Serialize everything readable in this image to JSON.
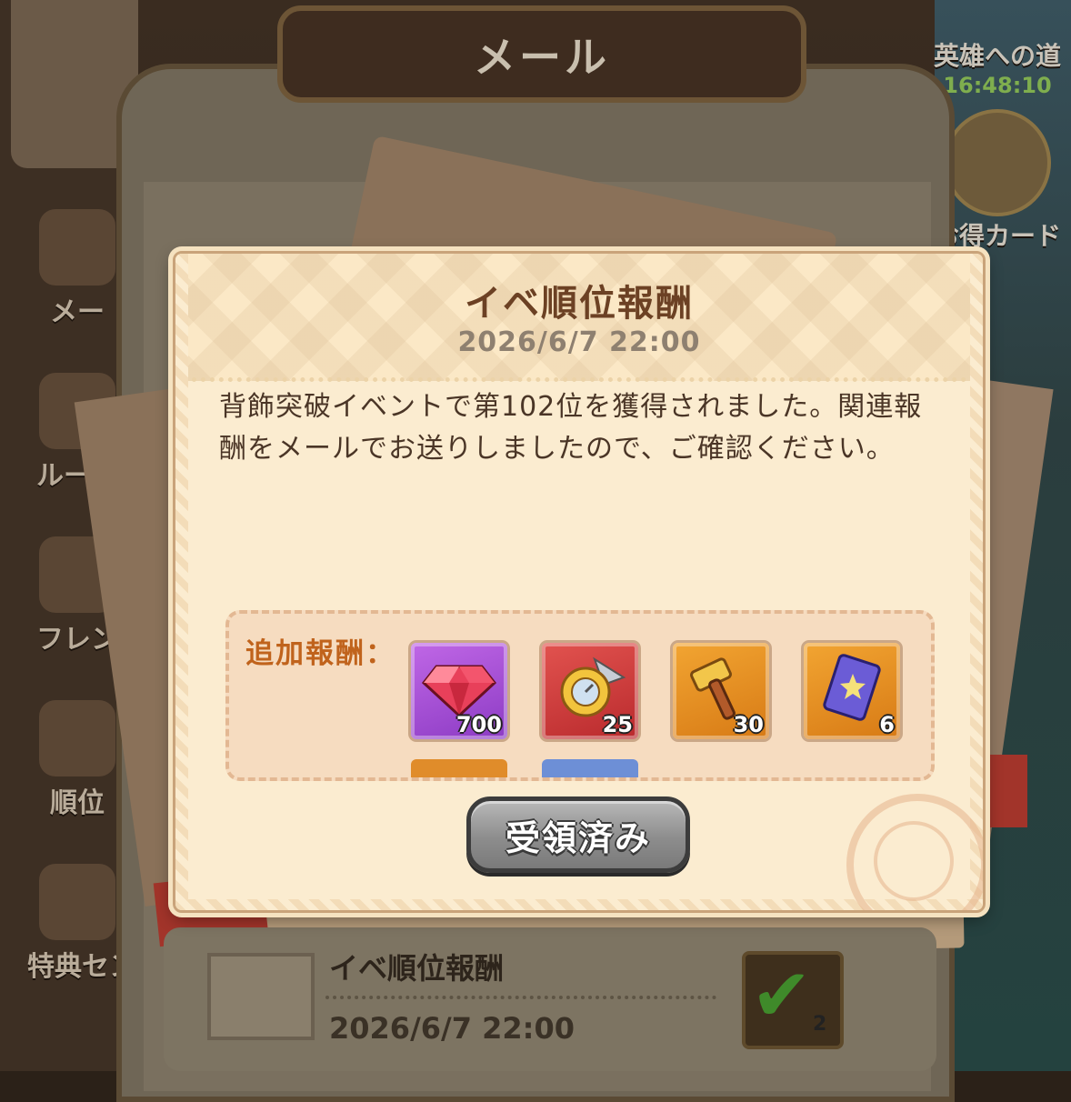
{
  "window_title": "メール",
  "sidebar": {
    "items": [
      {
        "label": "メー"
      },
      {
        "label": "ルーレ"
      },
      {
        "label": "フレン"
      },
      {
        "label": "順位"
      },
      {
        "label": "特典セン"
      }
    ]
  },
  "right_panel": {
    "hero_label": "英雄への道",
    "hero_timer": "16:48:10",
    "card_label": "お得カード"
  },
  "popup": {
    "title": "イベ順位報酬",
    "date": "2026/6/7  22:00",
    "body": "背飾突破イベントで第102位を獲得されました。関連報酬をメールでお送りしましたので、ご確認ください。",
    "reward_label": "追加報酬：",
    "rewards": [
      {
        "icon": "gem-icon",
        "count": "700",
        "frame": "purple"
      },
      {
        "icon": "compass-axe-icon",
        "count": "25",
        "frame": "red"
      },
      {
        "icon": "hammer-icon",
        "count": "30",
        "frame": "orange"
      },
      {
        "icon": "card-icon",
        "count": "6",
        "frame": "orange"
      }
    ],
    "claim_button": "受領済み"
  },
  "mail_list": {
    "item_title": "イベ順位報酬",
    "item_date": "2026/6/7  22:00",
    "item_count": "2"
  },
  "colors": {
    "title_text": "#6c4124",
    "reward_label": "#c0631c",
    "paper": "#fbecd0"
  }
}
